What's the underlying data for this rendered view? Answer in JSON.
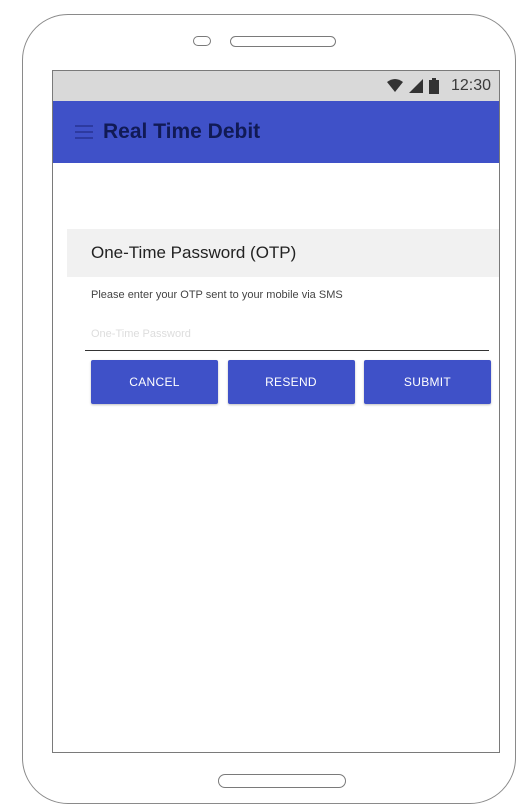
{
  "device": {
    "icons": [
      "speaker-dot-icon",
      "speaker-slot-icon",
      "home-button"
    ]
  },
  "status_bar": {
    "time": "12:30",
    "icons": [
      "wifi-icon",
      "signal-icon",
      "battery-icon"
    ]
  },
  "app_bar": {
    "title": "Real Time Debit",
    "menu_icon": "hamburger-menu-icon",
    "color": "#3f51c8"
  },
  "otp_form": {
    "header": "One-Time Password (OTP)",
    "instruction": "Please enter your OTP sent to your mobile via SMS",
    "input": {
      "value": "",
      "placeholder": "One-Time Password"
    },
    "buttons": {
      "cancel": "CANCEL",
      "resend": "RESEND",
      "submit": "SUBMIT"
    }
  }
}
